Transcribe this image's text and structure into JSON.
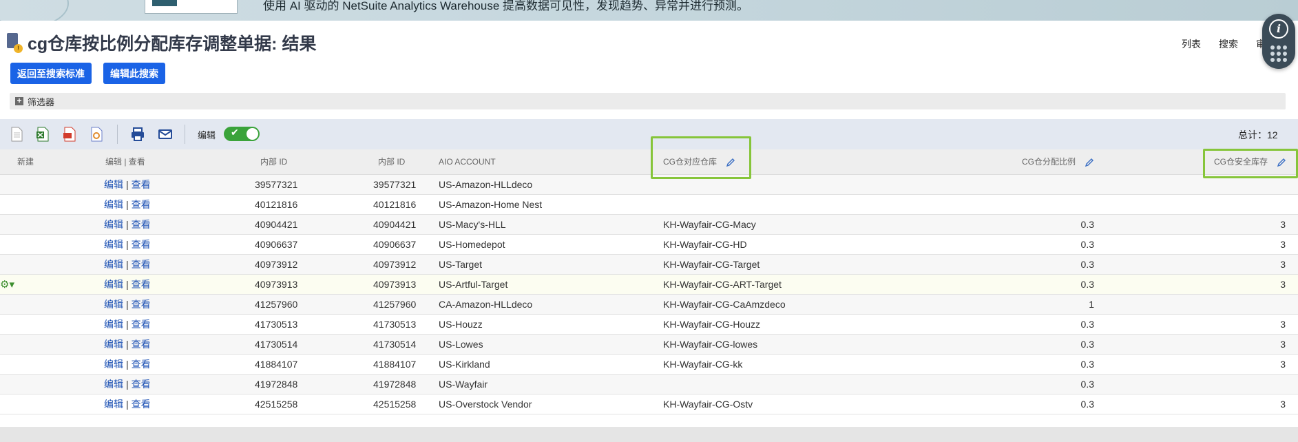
{
  "banner": {
    "text": "使用 AI 驱动的 NetSuite Analytics Warehouse 提高数据可见性，发现趋势、异常并进行预测。"
  },
  "page": {
    "title": "cg仓库按比例分配库存调整单据: 结果"
  },
  "top_links": {
    "list": "列表",
    "search": "搜索",
    "audit": "审计"
  },
  "buttons": {
    "back_to_criteria": "返回至搜索标准",
    "edit_search": "编辑此搜索"
  },
  "filters": {
    "label": "筛选器"
  },
  "toolbar": {
    "edit_label": "编辑",
    "total": "总计：12"
  },
  "table": {
    "headers": {
      "new": "新建",
      "edit_view": "编辑 | 查看",
      "internal_id_1": "内部 ID",
      "internal_id_2": "内部 ID",
      "aio_account": "AIO ACCOUNT",
      "cg_warehouse": "CG仓对应仓库",
      "cg_ratio": "CG仓分配比例",
      "cg_safety_stock": "CG仓安全库存"
    },
    "edit_text": "编辑",
    "view_text": "查看",
    "rows": [
      {
        "id1": "39577321",
        "id2": "39577321",
        "account": "US-Amazon-HLLdeco",
        "warehouse": "",
        "ratio": "",
        "stock": ""
      },
      {
        "id1": "40121816",
        "id2": "40121816",
        "account": "US-Amazon-Home Nest",
        "warehouse": "",
        "ratio": "",
        "stock": ""
      },
      {
        "id1": "40904421",
        "id2": "40904421",
        "account": "US-Macy's-HLL",
        "warehouse": "KH-Wayfair-CG-Macy",
        "ratio": "0.3",
        "stock": "3"
      },
      {
        "id1": "40906637",
        "id2": "40906637",
        "account": "US-Homedepot",
        "warehouse": "KH-Wayfair-CG-HD",
        "ratio": "0.3",
        "stock": "3"
      },
      {
        "id1": "40973912",
        "id2": "40973912",
        "account": "US-Target",
        "warehouse": "KH-Wayfair-CG-Target",
        "ratio": "0.3",
        "stock": "3"
      },
      {
        "id1": "40973913",
        "id2": "40973913",
        "account": "US-Artful-Target",
        "warehouse": "KH-Wayfair-CG-ART-Target",
        "ratio": "0.3",
        "stock": "3"
      },
      {
        "id1": "41257960",
        "id2": "41257960",
        "account": "CA-Amazon-HLLdeco",
        "warehouse": "KH-Wayfair-CG-CaAmzdeco",
        "ratio": "1",
        "stock": ""
      },
      {
        "id1": "41730513",
        "id2": "41730513",
        "account": "US-Houzz",
        "warehouse": "KH-Wayfair-CG-Houzz",
        "ratio": "0.3",
        "stock": "3"
      },
      {
        "id1": "41730514",
        "id2": "41730514",
        "account": "US-Lowes",
        "warehouse": "KH-Wayfair-CG-lowes",
        "ratio": "0.3",
        "stock": "3"
      },
      {
        "id1": "41884107",
        "id2": "41884107",
        "account": "US-Kirkland",
        "warehouse": "KH-Wayfair-CG-kk",
        "ratio": "0.3",
        "stock": "3"
      },
      {
        "id1": "41972848",
        "id2": "41972848",
        "account": "US-Wayfair",
        "warehouse": "",
        "ratio": "0.3",
        "stock": ""
      },
      {
        "id1": "42515258",
        "id2": "42515258",
        "account": "US-Overstock Vendor",
        "warehouse": "KH-Wayfair-CG-Ostv",
        "ratio": "0.3",
        "stock": "3"
      }
    ]
  },
  "colors": {
    "primary_button": "#1a63e6",
    "highlight_box": "#86c53a",
    "toggle_on": "#3aa33a",
    "link": "#1a4fb3"
  }
}
